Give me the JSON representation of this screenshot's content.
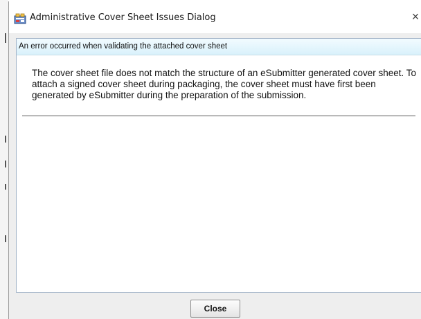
{
  "window": {
    "title": "Administrative Cover Sheet Issues Dialog",
    "app_icon": "esubmitter-app-icon",
    "close_glyph": "×"
  },
  "error_header": {
    "text": "An error occurred when validating the attached cover sheet"
  },
  "message": {
    "text": "The cover sheet file does not match the structure of an eSubmitter generated cover sheet. To attach a signed cover sheet during packaging, the cover sheet must have first been generated by eSubmitter during the preparation of the submission."
  },
  "footer": {
    "close_label": "Close"
  },
  "colors": {
    "header_band": "#d9f1fb",
    "content_border": "#a3b4c8",
    "dialog_background": "#eeeeee"
  }
}
